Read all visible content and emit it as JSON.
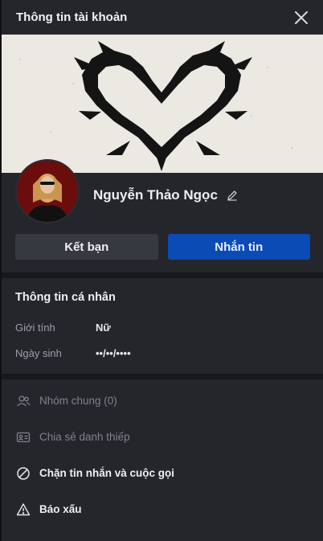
{
  "header": {
    "title": "Thông tin tài khoản",
    "close_icon": "close-icon"
  },
  "profile": {
    "name": "Nguyễn Thảo Ngọc",
    "edit_icon": "pencil-icon"
  },
  "actions": {
    "add_friend": "Kết bạn",
    "message": "Nhắn tin"
  },
  "personal_info": {
    "title": "Thông tin cá nhân",
    "gender_label": "Giới tính",
    "gender_value": "Nữ",
    "birthday_label": "Ngày sinh",
    "birthday_value": "••/••/••••"
  },
  "menu": {
    "common_groups": "Nhóm chung (0)",
    "share_card": "Chia sẻ danh thiếp",
    "block": "Chặn tin nhắn và cuộc gọi",
    "report": "Báo xấu"
  },
  "colors": {
    "accent": "#0a4bb5",
    "panel": "#24262b",
    "divider": "#17181b"
  }
}
